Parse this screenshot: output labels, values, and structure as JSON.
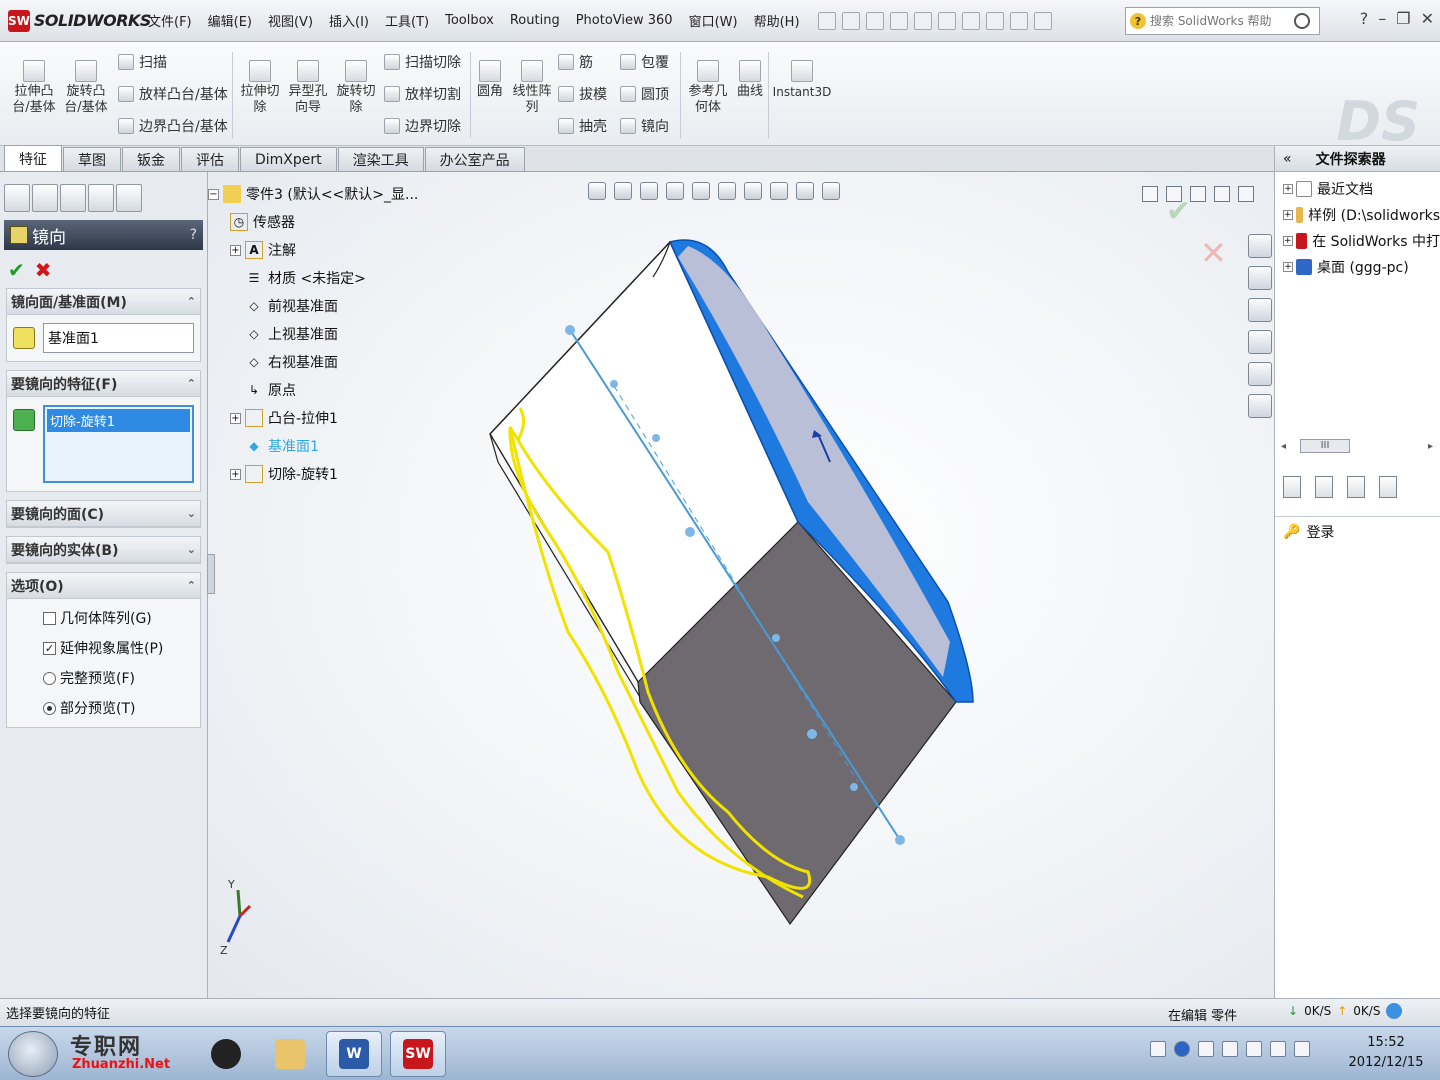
{
  "app": {
    "brand": "SOLIDWORKS",
    "menu": [
      "文件(F)",
      "编辑(E)",
      "视图(V)",
      "插入(I)",
      "工具(T)",
      "Toolbox",
      "Routing",
      "PhotoView 360",
      "窗口(W)",
      "帮助(H)"
    ],
    "search_placeholder": "搜索 SolidWorks 帮助"
  },
  "commands": {
    "big": [
      {
        "label": "拉伸凸\n台/基体"
      },
      {
        "label": "旋转凸\n台/基体"
      },
      {
        "label": "拉伸切\n除"
      },
      {
        "label": "异型孔\n向导"
      },
      {
        "label": "旋转切\n除"
      },
      {
        "label": "圆角"
      },
      {
        "label": "线性阵\n列"
      },
      {
        "label": "参考几\n何体"
      },
      {
        "label": "曲线"
      },
      {
        "label": "Instant3D"
      }
    ],
    "small": [
      "扫描",
      "放样凸台/基体",
      "边界凸台/基体",
      "扫描切除",
      "放样切割",
      "边界切除",
      "筋",
      "拔模",
      "抽壳",
      "包覆",
      "圆顶",
      "镜向"
    ]
  },
  "tabs": [
    "特征",
    "草图",
    "钣金",
    "评估",
    "DimXpert",
    "渲染工具",
    "办公室产品"
  ],
  "property_manager": {
    "title": "镜向",
    "help": "?",
    "groups": {
      "mirror_plane": {
        "title": "镜向面/基准面(M)",
        "value": "基准面1"
      },
      "features": {
        "title": "要镜向的特征(F)",
        "items": [
          "切除-旋转1"
        ]
      },
      "faces": {
        "title": "要镜向的面(C)"
      },
      "bodies": {
        "title": "要镜向的实体(B)"
      },
      "options": {
        "title": "选项(O)",
        "geometry_pattern": "几何体阵列(G)",
        "propagate_visual": "延伸视象属性(P)",
        "full_preview": "完整预览(F)",
        "partial_preview": "部分预览(T)"
      }
    }
  },
  "feature_tree": [
    {
      "label": "零件3  (默认<<默认>_显..."
    },
    {
      "label": "传感器"
    },
    {
      "label": "注解"
    },
    {
      "label": "材质 <未指定>"
    },
    {
      "label": "前视基准面"
    },
    {
      "label": "上视基准面"
    },
    {
      "label": "右视基准面"
    },
    {
      "label": "原点"
    },
    {
      "label": "凸台-拉伸1"
    },
    {
      "label": "基准面1"
    },
    {
      "label": "切除-旋转1"
    }
  ],
  "axes": {
    "y": "Y",
    "z": "Z"
  },
  "task_pane": {
    "title": "文件探索器",
    "back": "«",
    "items": [
      "最近文档",
      "样例 (D:\\solidworks",
      "在 SolidWorks 中打",
      "桌面 (ggg-pc)"
    ],
    "scroll_thumb": "III",
    "login": "登录"
  },
  "status": {
    "left": "选择要镜向的特征",
    "right": "在编辑 零件",
    "down": "0K/S",
    "up": "0K/S"
  },
  "taskbar": {
    "watermark": "专职网",
    "watermark_sub": "Zhuanzhi.Net",
    "time": "15:52",
    "date": "2012/12/15"
  }
}
